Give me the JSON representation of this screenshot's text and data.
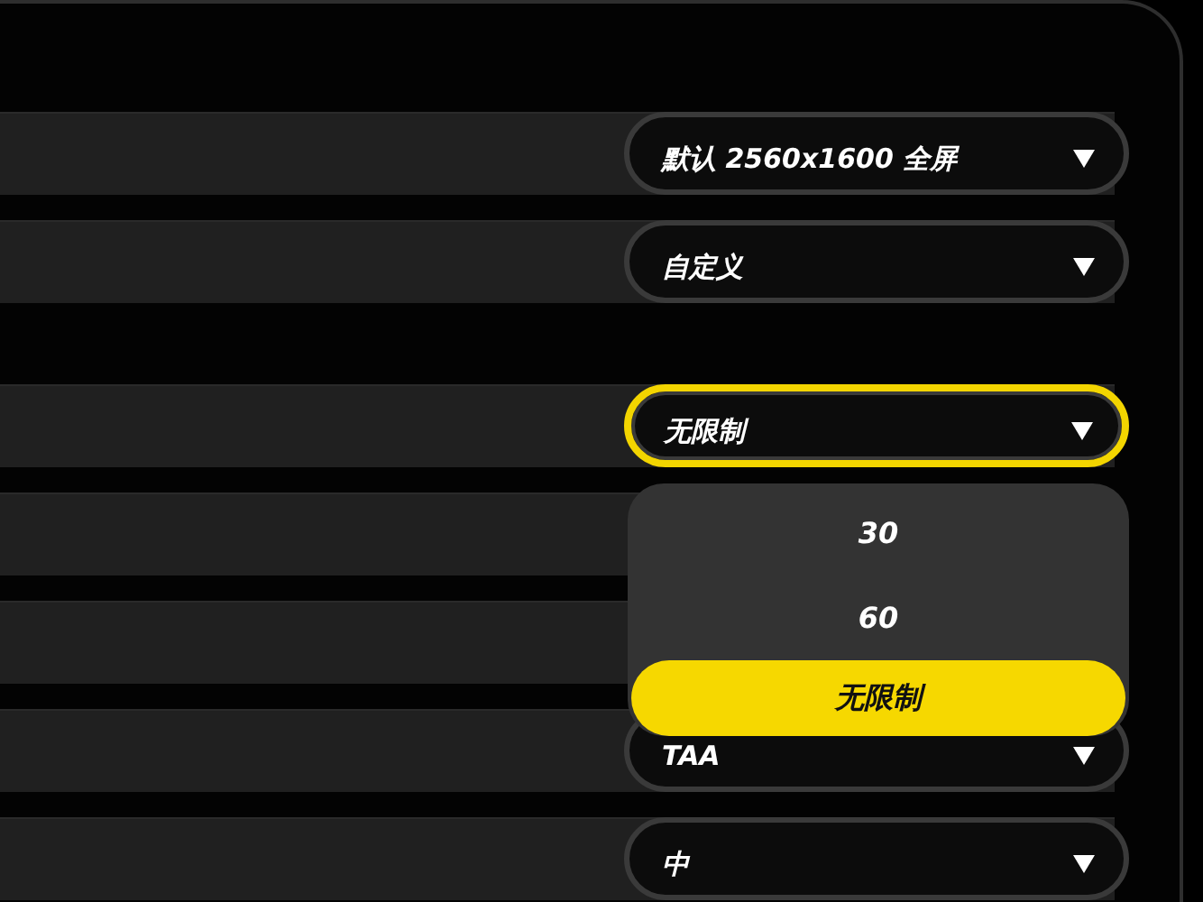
{
  "sections": [
    {
      "rows": [
        {
          "value": "默认 2560x1600 全屏",
          "focused": false
        },
        {
          "value": "自定义",
          "focused": false
        }
      ]
    },
    {
      "rows": [
        {
          "value": "无限制",
          "focused": true,
          "menu": [
            {
              "label": "30",
              "selected": false
            },
            {
              "label": "60",
              "selected": false
            },
            {
              "label": "无限制",
              "selected": true
            }
          ]
        },
        {},
        {},
        {
          "value": "TAA",
          "focused": false
        },
        {
          "value": "中",
          "focused": false
        }
      ]
    }
  ]
}
